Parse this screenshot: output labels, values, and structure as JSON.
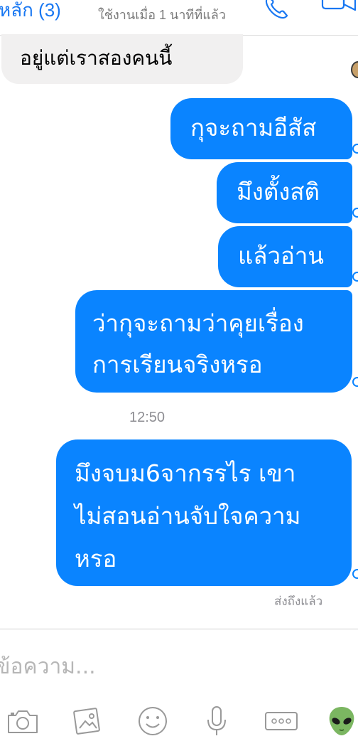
{
  "header": {
    "contact_name": "หลัก (3)",
    "status": "ใช้งานเมื่อ 1 นาทีที่แล้ว",
    "call_icon": "phone-icon",
    "video_icon": "video-camera-icon"
  },
  "messages": {
    "incoming_text": "อยู่แต่เราสองคนนี้",
    "outgoing": [
      "กุจะถามอีสัส",
      "มึงตั้งสติ",
      "แล้วอ่าน",
      "ว่ากุจะถามว่าคุยเรื่อง",
      "การเรียนจริงหรอ",
      "มึงจบม6จากรรไร เขา",
      "ไม่สอนอ่านจับใจความ",
      "หรอ"
    ],
    "timestamp": "12:50",
    "delivery_status": "ส่งถึงแล้ว"
  },
  "composer": {
    "placeholder": "ข้อความ..."
  },
  "toolbar": {
    "icons": [
      "camera-icon",
      "photo-icon",
      "emoji-icon",
      "microphone-icon",
      "more-icon",
      "alien-emoji-icon"
    ]
  },
  "colors": {
    "accent": "#0a84ff",
    "header_accent": "#1877f2",
    "incoming_bubble": "#f1f0f0",
    "muted_text": "#8e8e93"
  }
}
